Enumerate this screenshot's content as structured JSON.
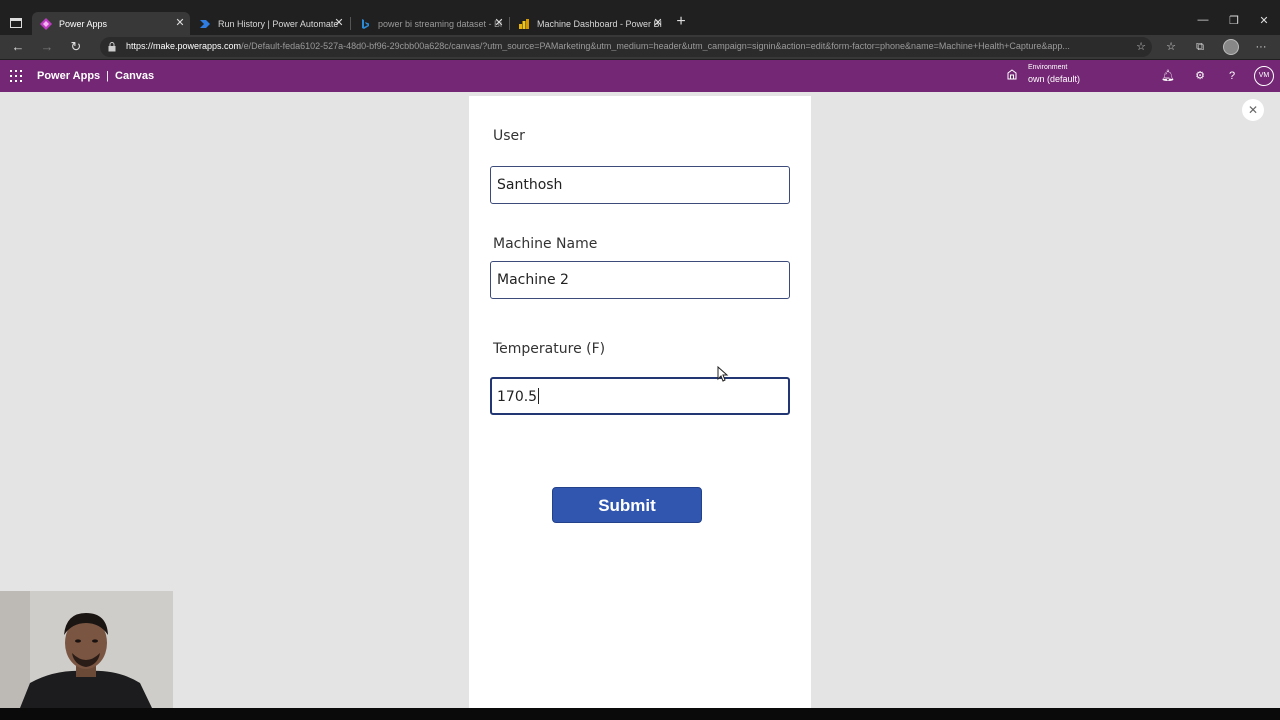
{
  "browser": {
    "tabs": [
      {
        "label": "Power Apps",
        "active": true,
        "icon": "power-apps-icon"
      },
      {
        "label": "Run History | Power Automate",
        "active": false,
        "icon": "power-automate-icon"
      },
      {
        "label": "power bi streaming dataset - Bi",
        "active": false,
        "icon": "bing-icon"
      },
      {
        "label": "Machine Dashboard - Power BI",
        "active": false,
        "icon": "power-bi-icon"
      }
    ],
    "url_host": "https://make.powerapps.com",
    "url_path": "/e/Default-feda6102-527a-48d0-bf96-29cbb00a628c/canvas/?utm_source=PAMarketing&utm_medium=header&utm_campaign=signin&action=edit&form-factor=phone&name=Machine+Health+Capture&app..."
  },
  "header": {
    "app_name": "Power Apps",
    "separator": "|",
    "section": "Canvas",
    "environment_label": "Environment",
    "environment_value": "own (default)",
    "avatar_initials": "VM"
  },
  "form": {
    "user_label": "User",
    "user_value": "Santhosh",
    "machine_label": "Machine Name",
    "machine_value": "Machine 2",
    "temp_label": "Temperature (F)",
    "temp_value": "170.5",
    "submit_label": "Submit"
  },
  "colors": {
    "header_bg": "#742774",
    "submit_bg": "#3056b0",
    "canvas_bg": "#e4e4e4"
  }
}
